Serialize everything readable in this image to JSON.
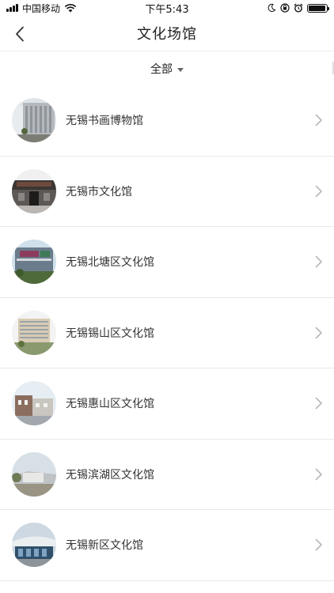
{
  "status_bar": {
    "carrier": "中国移动",
    "time": "下午5:43",
    "battery_level": 0.95
  },
  "nav": {
    "title": "文化场馆",
    "back_icon": "chevron-left-icon"
  },
  "filter": {
    "label": "全部",
    "icon": "caret-down-icon"
  },
  "venues": [
    {
      "name": "无锡书画博物馆"
    },
    {
      "name": "无锡市文化馆"
    },
    {
      "name": "无锡北塘区文化馆"
    },
    {
      "name": "无锡锡山区文化馆"
    },
    {
      "name": "无锡惠山区文化馆"
    },
    {
      "name": "无锡滨湖区文化馆"
    },
    {
      "name": "无锡新区文化馆"
    }
  ],
  "colors": {
    "background": "#ffffff",
    "divider": "#e8e8e8",
    "text": "#333333",
    "chevron": "#b8b8b8"
  }
}
